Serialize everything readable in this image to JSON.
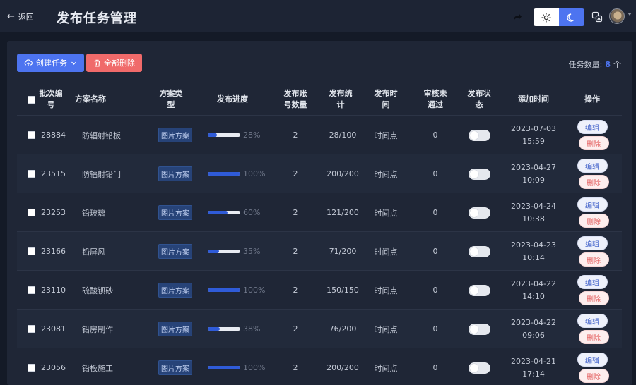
{
  "header": {
    "back_label": "返回",
    "title": "发布任务管理",
    "icons": [
      "share-icon",
      "sun-icon",
      "moon-icon",
      "translate-icon"
    ],
    "theme": "dark"
  },
  "toolbar": {
    "create_label": "创建任务",
    "delete_all_label": "全部删除",
    "task_count_label": "任务数量:",
    "task_count": "8",
    "task_count_unit": "个"
  },
  "colors": {
    "accent": "#4d74f0",
    "danger": "#f06a6a",
    "background": "#141a27",
    "panel": "#1f2636"
  },
  "table": {
    "headers": {
      "batch_no": "批次编\n号",
      "plan_name": "方案名称",
      "plan_type": "方案类\n型",
      "progress": "发布进度",
      "accounts": "发布账\n号数量",
      "stats": "发布统\n计",
      "publish_time": "发布时\n间",
      "rejected": "审核未\n通过",
      "status": "发布状\n态",
      "added_time": "添加时间",
      "actions": "操作"
    },
    "edit_label": "编辑",
    "delete_label": "删除",
    "rows": [
      {
        "id": "28884",
        "name": "防辐射铅板",
        "type": "图片方案",
        "progress": 28,
        "progress_label": "28%",
        "accounts": "2",
        "stats": "28/100",
        "time_type": "时间点",
        "rejected": "0",
        "enabled": false,
        "date": "2023-07-03",
        "time": "15:59"
      },
      {
        "id": "23515",
        "name": "防辐射铅门",
        "type": "图片方案",
        "progress": 100,
        "progress_label": "100%",
        "accounts": "2",
        "stats": "200/200",
        "time_type": "时间点",
        "rejected": "0",
        "enabled": false,
        "date": "2023-04-27",
        "time": "10:09"
      },
      {
        "id": "23253",
        "name": "铅玻璃",
        "type": "图片方案",
        "progress": 60,
        "progress_label": "60%",
        "accounts": "2",
        "stats": "121/200",
        "time_type": "时间点",
        "rejected": "0",
        "enabled": false,
        "date": "2023-04-24",
        "time": "10:38"
      },
      {
        "id": "23166",
        "name": "铅屏风",
        "type": "图片方案",
        "progress": 35,
        "progress_label": "35%",
        "accounts": "2",
        "stats": "71/200",
        "time_type": "时间点",
        "rejected": "0",
        "enabled": false,
        "date": "2023-04-23",
        "time": "10:14"
      },
      {
        "id": "23110",
        "name": "硫酸钡砂",
        "type": "图片方案",
        "progress": 100,
        "progress_label": "100%",
        "accounts": "2",
        "stats": "150/150",
        "time_type": "时间点",
        "rejected": "0",
        "enabled": false,
        "date": "2023-04-22",
        "time": "14:10"
      },
      {
        "id": "23081",
        "name": "铅房制作",
        "type": "图片方案",
        "progress": 38,
        "progress_label": "38%",
        "accounts": "2",
        "stats": "76/200",
        "time_type": "时间点",
        "rejected": "0",
        "enabled": false,
        "date": "2023-04-22",
        "time": "09:06"
      },
      {
        "id": "23056",
        "name": "铅板施工",
        "type": "图片方案",
        "progress": 100,
        "progress_label": "100%",
        "accounts": "2",
        "stats": "200/200",
        "time_type": "时间点",
        "rejected": "0",
        "enabled": false,
        "date": "2023-04-21",
        "time": "17:14"
      }
    ]
  }
}
